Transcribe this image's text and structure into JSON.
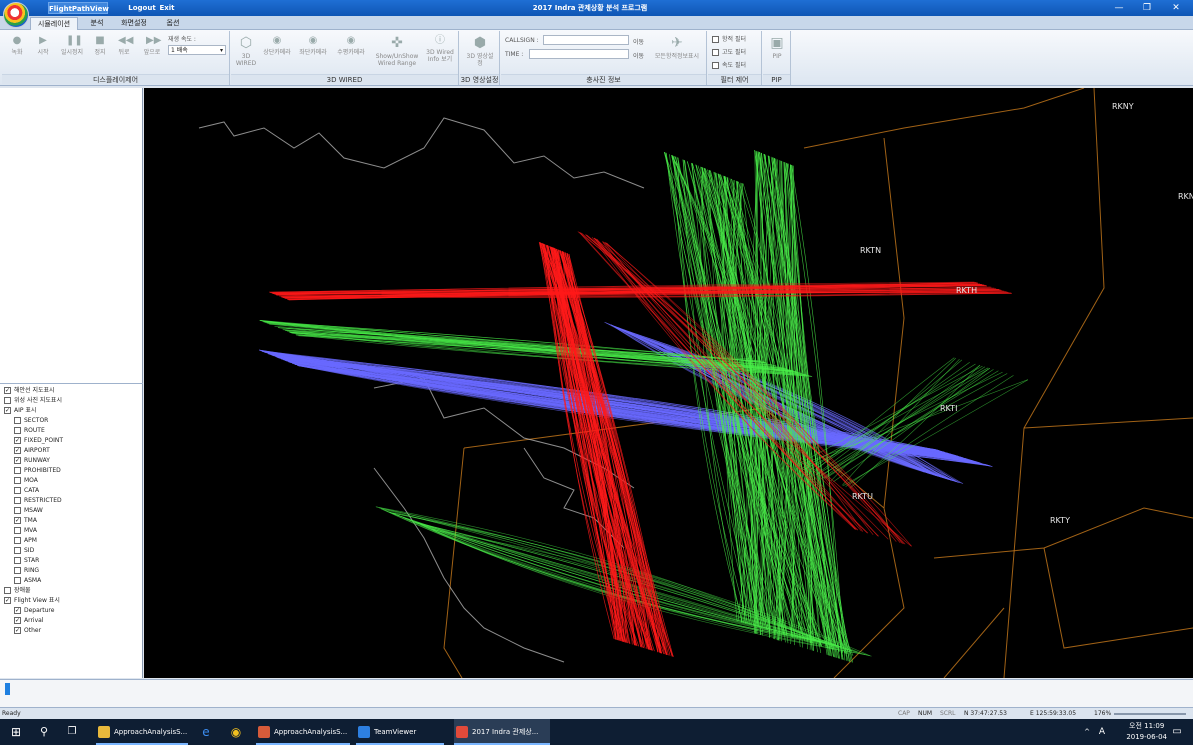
{
  "titlebar": {
    "quick_access": [
      "FlightPathView",
      "Logout",
      "Exit"
    ],
    "title": "2017 Indra 관제상황 분석 프로그램",
    "controls": [
      "—",
      "❐",
      "✕"
    ]
  },
  "menu_tabs": [
    "시뮬레이션",
    "분석",
    "화면설정",
    "옵션"
  ],
  "ribbon": {
    "groups": {
      "display": {
        "label": "디스플레이제어",
        "buttons": [
          "녹화",
          "시작",
          "일시정지",
          "정지",
          "뒤로",
          "앞으로"
        ],
        "speed_label": "재생 속도 :",
        "speed_value": "1 배속"
      },
      "wired": {
        "label": "3D WIRED",
        "buttons": [
          "3D WIRED",
          "상단카메라",
          "좌단카메라",
          "수평카메라",
          "Show/UnShow Wired Range",
          "3D Wired Info 보기"
        ]
      },
      "video": {
        "label": "3D 영상설정",
        "button": "3D 영상설정"
      },
      "collision": {
        "label": "충사진 정보",
        "fields": [
          "CALLSIGN :",
          "TIME :"
        ],
        "suffix": [
          "이동",
          "이동"
        ],
        "button": "모든항적정보표시"
      },
      "filter": {
        "label": "필터 제어",
        "checks": [
          "항적 필터",
          "고도 필터",
          "속도 필터"
        ]
      },
      "pip": {
        "label": "PIP",
        "button": "PIP"
      }
    }
  },
  "layer_tree": [
    {
      "label": "해안선 지도표시",
      "checked": true,
      "level": 0
    },
    {
      "label": "위성 사진 지도표시",
      "checked": false,
      "level": 0
    },
    {
      "label": "AIP 표시",
      "checked": true,
      "level": 0
    },
    {
      "label": "SECTOR",
      "checked": false,
      "level": 1
    },
    {
      "label": "ROUTE",
      "checked": false,
      "level": 1
    },
    {
      "label": "FIXED_POINT",
      "checked": true,
      "level": 1
    },
    {
      "label": "AIRPORT",
      "checked": true,
      "level": 1
    },
    {
      "label": "RUNWAY",
      "checked": true,
      "level": 1
    },
    {
      "label": "PROHIBITED",
      "checked": false,
      "level": 1
    },
    {
      "label": "MOA",
      "checked": false,
      "level": 1
    },
    {
      "label": "CATA",
      "checked": false,
      "level": 1
    },
    {
      "label": "RESTRICTED",
      "checked": false,
      "level": 1
    },
    {
      "label": "MSAW",
      "checked": false,
      "level": 1
    },
    {
      "label": "TMA",
      "checked": true,
      "level": 1
    },
    {
      "label": "MVA",
      "checked": false,
      "level": 1
    },
    {
      "label": "APM",
      "checked": false,
      "level": 1
    },
    {
      "label": "SID",
      "checked": false,
      "level": 1
    },
    {
      "label": "STAR",
      "checked": false,
      "level": 1
    },
    {
      "label": "RING",
      "checked": false,
      "level": 1
    },
    {
      "label": "ASMA",
      "checked": false,
      "level": 1
    },
    {
      "label": "장애물",
      "checked": false,
      "level": 0
    },
    {
      "label": "Flight View 표시",
      "checked": true,
      "level": 0
    },
    {
      "label": "Departure",
      "checked": true,
      "level": 1
    },
    {
      "label": "Arrival",
      "checked": true,
      "level": 1
    },
    {
      "label": "Other",
      "checked": true,
      "level": 1
    }
  ],
  "map": {
    "airports": [
      "RKNY",
      "RKNW",
      "RKTH",
      "RKTN",
      "RKTI",
      "RKTU",
      "RKTY"
    ],
    "track_colors": {
      "departure": "#ff1a1a",
      "arrival": "#4aee4a",
      "other": "#6a6aff"
    },
    "coastline_color": "#c9c9c9",
    "boundary_color": "#c97a1c"
  },
  "statusbar": {
    "ready": "Ready",
    "cap": "CAP",
    "num": "NUM",
    "scrl": "SCRL",
    "lat": "N 37:47:27.53",
    "lon": "E 125:59:33.05",
    "zoom": "176%"
  },
  "taskbar": {
    "apps": [
      "ApproachAnalysisS...",
      "ApproachAnalysisS...",
      "TeamViewer",
      "2017 Indra 관제상..."
    ],
    "time": "오전 11:09",
    "date": "2019-06-04",
    "ime": "A"
  }
}
